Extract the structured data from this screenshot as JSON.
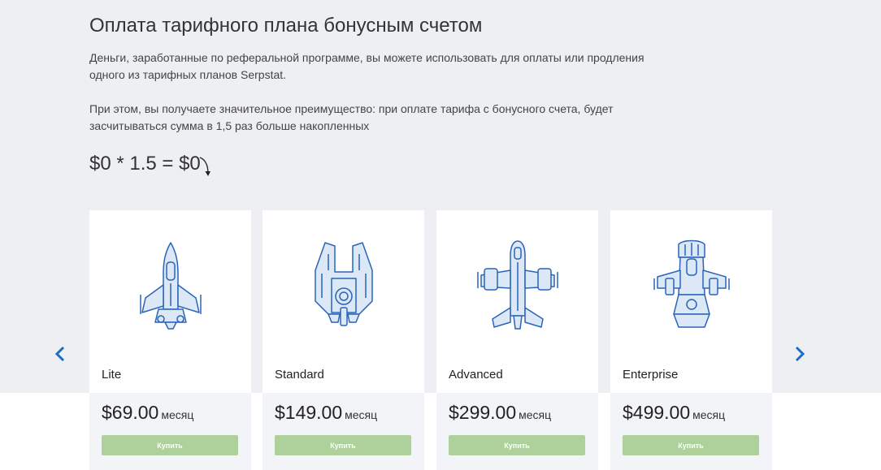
{
  "page": {
    "title": "Оплата тарифного плана бонусным счетом",
    "paragraph1": "Деньги, заработанные по реферальной программе, вы можете использовать для оплаты или продления одного из тарифных планов Serpstat.",
    "paragraph2": "При этом, вы получаете значительное преимущество: при оплате тарифа с бонусного счета, будет засчитываться сумма в 1,5 раз больше накопленных",
    "formula": "$0 * 1.5 = $0"
  },
  "carousel": {
    "prev_icon": "chevron-left-icon",
    "next_icon": "chevron-right-icon",
    "accent_color": "#1a6fc2"
  },
  "plans": [
    {
      "name": "Lite",
      "price": "$69.00",
      "period": "месяц",
      "button": "Купить",
      "icon": "rocket-lite-icon"
    },
    {
      "name": "Standard",
      "price": "$149.00",
      "period": "месяц",
      "button": "Купить",
      "icon": "rocket-standard-icon"
    },
    {
      "name": "Advanced",
      "price": "$299.00",
      "period": "месяц",
      "button": "Купить",
      "icon": "rocket-advanced-icon"
    },
    {
      "name": "Enterprise",
      "price": "$499.00",
      "period": "месяц",
      "button": "Купить",
      "icon": "rocket-enterprise-icon"
    }
  ],
  "colors": {
    "button_bg": "#aed19b",
    "page_bg": "#eeeff3",
    "illustration_stroke": "#2a64b8",
    "illustration_fill": "#dde8f6"
  }
}
